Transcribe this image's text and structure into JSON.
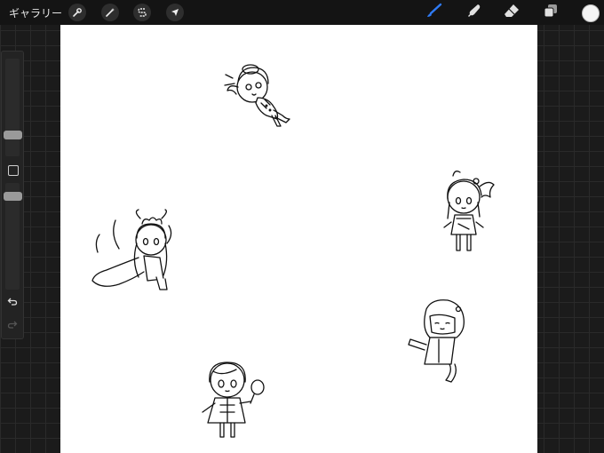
{
  "toolbar": {
    "gallery_label": "ギャラリー",
    "left_tools": [
      {
        "name": "actions",
        "icon": "wrench-icon"
      },
      {
        "name": "adjustments",
        "icon": "magic-wand-icon"
      },
      {
        "name": "selection",
        "icon": "selection-s-icon"
      },
      {
        "name": "transform",
        "icon": "arrow-cursor-icon"
      }
    ],
    "right_tools": [
      {
        "name": "brush",
        "icon": "brush-icon",
        "active": true
      },
      {
        "name": "smudge",
        "icon": "smudge-finger-icon",
        "active": false
      },
      {
        "name": "eraser",
        "icon": "eraser-icon",
        "active": false
      },
      {
        "name": "layers",
        "icon": "layers-icon",
        "active": false
      }
    ],
    "active_color": "#f4f4f4",
    "accent_color": "#2f7bf6"
  },
  "sidebar": {
    "brush_size_level": 0.3,
    "opacity_level": 0.55
  },
  "canvas": {
    "background": "#ffffff",
    "illustrations": [
      {
        "name": "chibi-girl-lying-down"
      },
      {
        "name": "chibi-girl-with-side-ponytail"
      },
      {
        "name": "chibi-girl-with-tentacles"
      },
      {
        "name": "chibi-girl-in-hood"
      },
      {
        "name": "chibi-girl-with-mirror"
      }
    ]
  }
}
